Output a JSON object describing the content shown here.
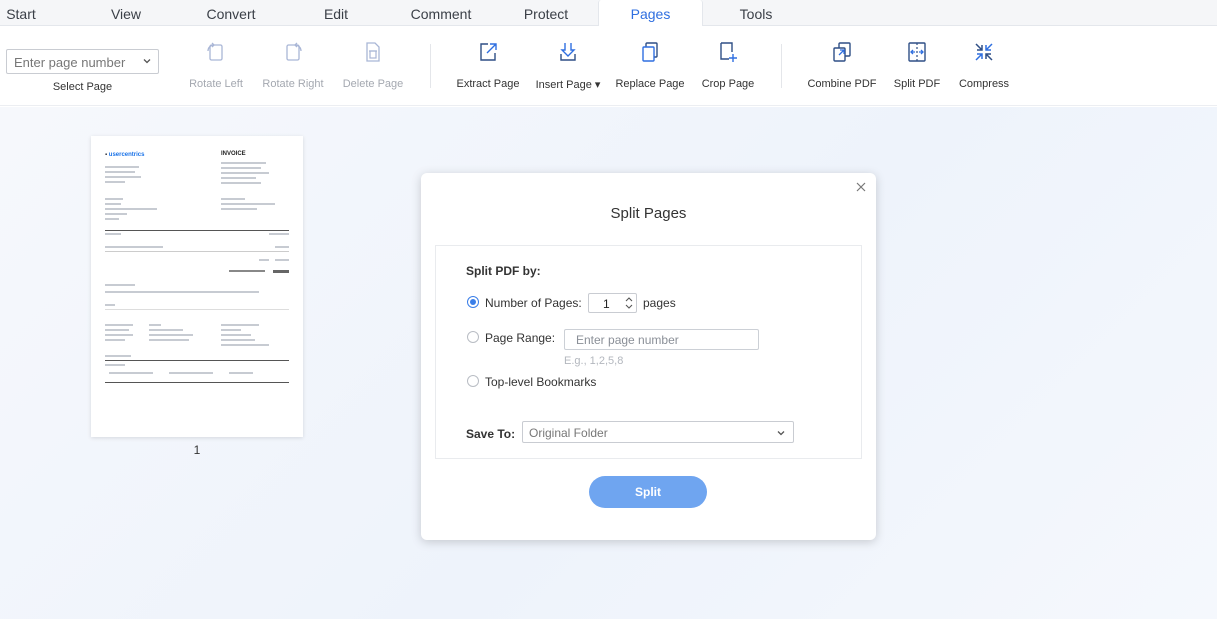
{
  "menu": {
    "tabs": [
      {
        "label": "Start"
      },
      {
        "label": "View"
      },
      {
        "label": "Convert"
      },
      {
        "label": "Edit"
      },
      {
        "label": "Comment"
      },
      {
        "label": "Protect"
      },
      {
        "label": "Pages"
      },
      {
        "label": "Tools"
      }
    ],
    "active": "Pages"
  },
  "toolbar": {
    "page_select_placeholder": "Enter page number",
    "page_select_label": "Select Page",
    "tools": [
      {
        "label": "Rotate Left",
        "icon": "rotate-left-icon",
        "enabled": false
      },
      {
        "label": "Rotate Right",
        "icon": "rotate-right-icon",
        "enabled": false
      },
      {
        "label": "Delete Page",
        "icon": "delete-page-icon",
        "enabled": false
      },
      {
        "label": "Extract Page",
        "icon": "extract-page-icon",
        "enabled": true
      },
      {
        "label": "Insert Page",
        "icon": "insert-page-icon",
        "enabled": true
      },
      {
        "label": "Replace Page",
        "icon": "replace-page-icon",
        "enabled": true
      },
      {
        "label": "Crop Page",
        "icon": "crop-page-icon",
        "enabled": true
      },
      {
        "label": "Combine PDF",
        "icon": "combine-pdf-icon",
        "enabled": true
      },
      {
        "label": "Split PDF",
        "icon": "split-pdf-icon",
        "enabled": true
      },
      {
        "label": "Compress",
        "icon": "compress-icon",
        "enabled": true
      }
    ]
  },
  "thumbnail": {
    "page_number": "1",
    "preview_title": "INVOICE",
    "preview_logo": "usercentrics"
  },
  "dialog": {
    "title": "Split Pages",
    "split_by_label": "Split PDF by:",
    "options": {
      "number_of_pages": "Number of Pages:",
      "page_range": "Page Range:",
      "bookmarks": "Top-level Bookmarks"
    },
    "selected_option": "number_of_pages",
    "pages_value": "1",
    "pages_unit": "pages",
    "range_placeholder": "Enter page number",
    "range_hint": "E.g., 1,2,5,8",
    "save_to_label": "Save To:",
    "save_to_value": "Original Folder",
    "split_button": "Split"
  },
  "colors": {
    "accent": "#2f6fe0",
    "button": "#6fa5f0"
  }
}
